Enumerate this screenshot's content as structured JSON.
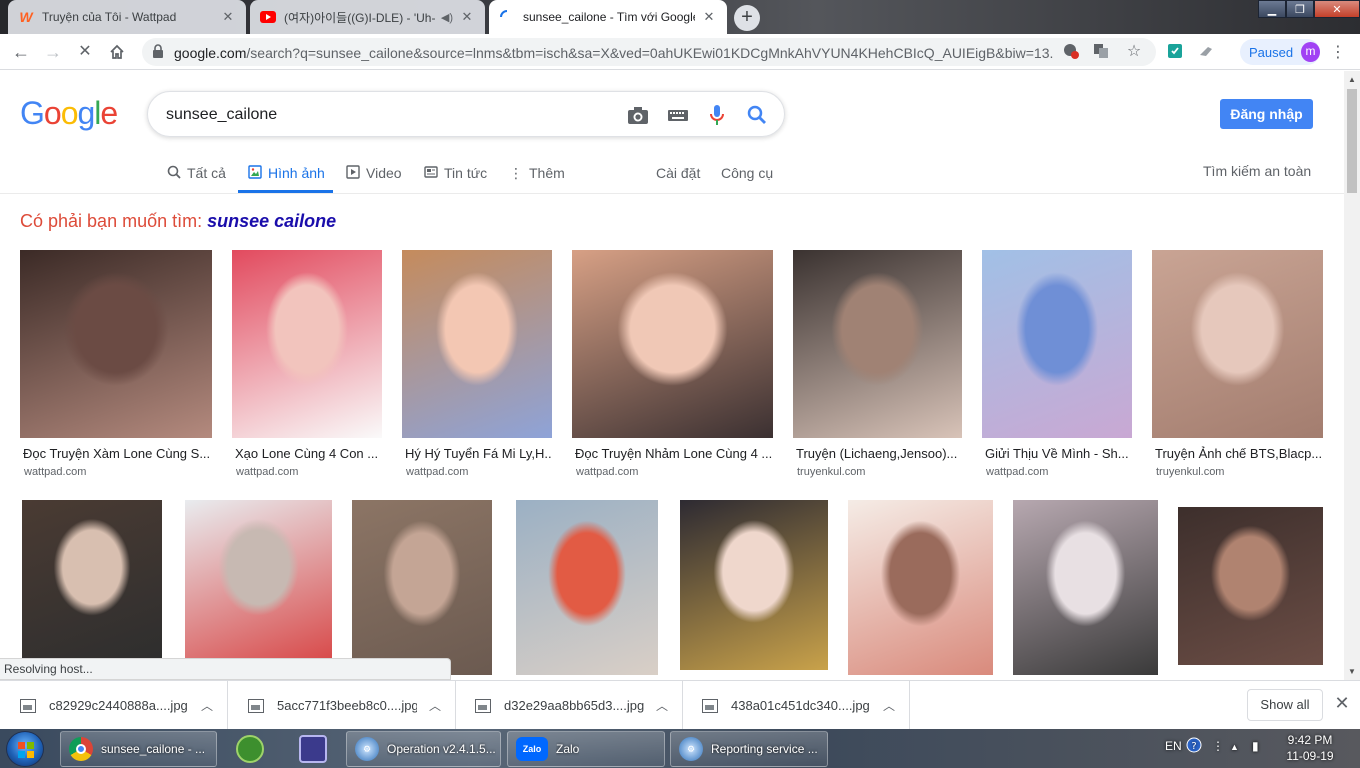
{
  "tabs": [
    {
      "title": "Truyện của Tôi - Wattpad",
      "favicon": "wattpad-icon",
      "favicon_glyph": "W",
      "favicon_color": "#ff6122"
    },
    {
      "title": "(여자)아이들((G)I-DLE) - 'Uh-",
      "favicon": "youtube-icon",
      "favicon_glyph": "▶",
      "favicon_color": "#ff0000"
    },
    {
      "title": "sunsee_cailone - Tìm với Google",
      "favicon": "loading-spinner-icon",
      "favicon_glyph": "◜",
      "favicon_color": "#1a73e8"
    }
  ],
  "toolbar": {
    "url_host": "google.com",
    "url_path": "/search?q=sunsee_cailone&source=lnms&tbm=isch&sa=X&ved=0ahUKEwi01KDCgMnkAhVYUN4KHehCBIcQ_AUIEigB&biw=13...",
    "paused_label": "Paused",
    "avatar_letter": "m"
  },
  "google": {
    "logo_letters": [
      {
        "ch": "G",
        "color": "#4285f4"
      },
      {
        "ch": "o",
        "color": "#ea4335"
      },
      {
        "ch": "o",
        "color": "#fbbc05"
      },
      {
        "ch": "g",
        "color": "#4285f4"
      },
      {
        "ch": "l",
        "color": "#34a853"
      },
      {
        "ch": "e",
        "color": "#ea4335"
      }
    ],
    "query": "sunsee_cailone",
    "signin_label": "Đăng nhập",
    "nav": {
      "all": "Tất cả",
      "images": "Hình ảnh",
      "video": "Video",
      "news": "Tin tức",
      "more": "Thêm",
      "settings": "Cài đặt",
      "tools": "Công cụ",
      "safesearch": "Tìm kiếm an toàn"
    },
    "did_you_mean": {
      "prefix": "Có phải bạn muốn tìm:",
      "suggestion": "sunsee cailone"
    }
  },
  "results_row1": [
    {
      "caption": "Đọc Truyện Xàm Lone Cùng S...",
      "source": "wattpad.com",
      "colors": [
        "#3b2a26",
        "#6b4b44",
        "#b48a7e"
      ]
    },
    {
      "caption": "Xạo Lone Cùng 4 Con ...",
      "source": "wattpad.com",
      "colors": [
        "#e24a5e",
        "#f2c4bd",
        "#fafafa"
      ]
    },
    {
      "caption": "Hý Hý Tuyển Fá Mi Ly,H...",
      "source": "wattpad.com",
      "colors": [
        "#c58b5c",
        "#f3c7b3",
        "#8ea3d8"
      ]
    },
    {
      "caption": "Đọc Truyện Nhảm Lone Cùng 4 ...",
      "source": "wattpad.com",
      "colors": [
        "#d7a085",
        "#f0c8b6",
        "#3b3031"
      ]
    },
    {
      "caption": "Truyện (Lichaeng,Jensoo)...",
      "source": "truyenkul.com",
      "colors": [
        "#3a3230",
        "#a08274",
        "#d8c3b8"
      ]
    },
    {
      "caption": "Giửi Thịu Về Mình - Sh...",
      "source": "wattpad.com",
      "colors": [
        "#a1c0e6",
        "#6f8fd6",
        "#c9a8d3"
      ]
    },
    {
      "caption": "Truyện Ảnh chế BTS,Blacp...",
      "source": "truyenkul.com",
      "colors": [
        "#c9a494",
        "#e6c8bc",
        "#a37d6f"
      ]
    }
  ],
  "results_row2": [
    {
      "colors": [
        "#4a3b33",
        "#d8bfb0",
        "#2e2e2e"
      ]
    },
    {
      "colors": [
        "#e9ecef",
        "#c7b9b2",
        "#d84a4a"
      ]
    },
    {
      "colors": [
        "#8c7565",
        "#c4a595",
        "#6b5a50"
      ]
    },
    {
      "colors": [
        "#9bb0c4",
        "#e25b44",
        "#d9cfc6"
      ]
    },
    {
      "colors": [
        "#2d2a32",
        "#efd7cc",
        "#c9a24a"
      ]
    },
    {
      "colors": [
        "#f5ece6",
        "#9a6b5c",
        "#d98a7c"
      ]
    },
    {
      "colors": [
        "#b7a8b0",
        "#e8e0e3",
        "#3a3a3a"
      ]
    },
    {
      "colors": [
        "#3d2f2c",
        "#b08370",
        "#6b4d45"
      ]
    }
  ],
  "status_text": "Resolving host...",
  "downloads": [
    {
      "name": "c82929c2440888a....jpg"
    },
    {
      "name": "5acc771f3beeb8c0....jpg"
    },
    {
      "name": "d32e29aa8bb65d3....jpg"
    },
    {
      "name": "438a01c451dc340....jpg"
    }
  ],
  "show_all_label": "Show all",
  "taskbar": {
    "tasks": [
      {
        "label": "sunsee_cailone - ...",
        "icon": "chrome-icon"
      },
      {
        "label": "Operation v2.4.1.5...",
        "icon": "gear-app-icon"
      },
      {
        "label": "Zalo",
        "icon": "zalo-icon",
        "glyph": "Zalo"
      },
      {
        "label": "Reporting service ...",
        "icon": "gear-app-icon"
      }
    ],
    "language": "EN",
    "time": "9:42 PM",
    "date": "11-09-19"
  }
}
